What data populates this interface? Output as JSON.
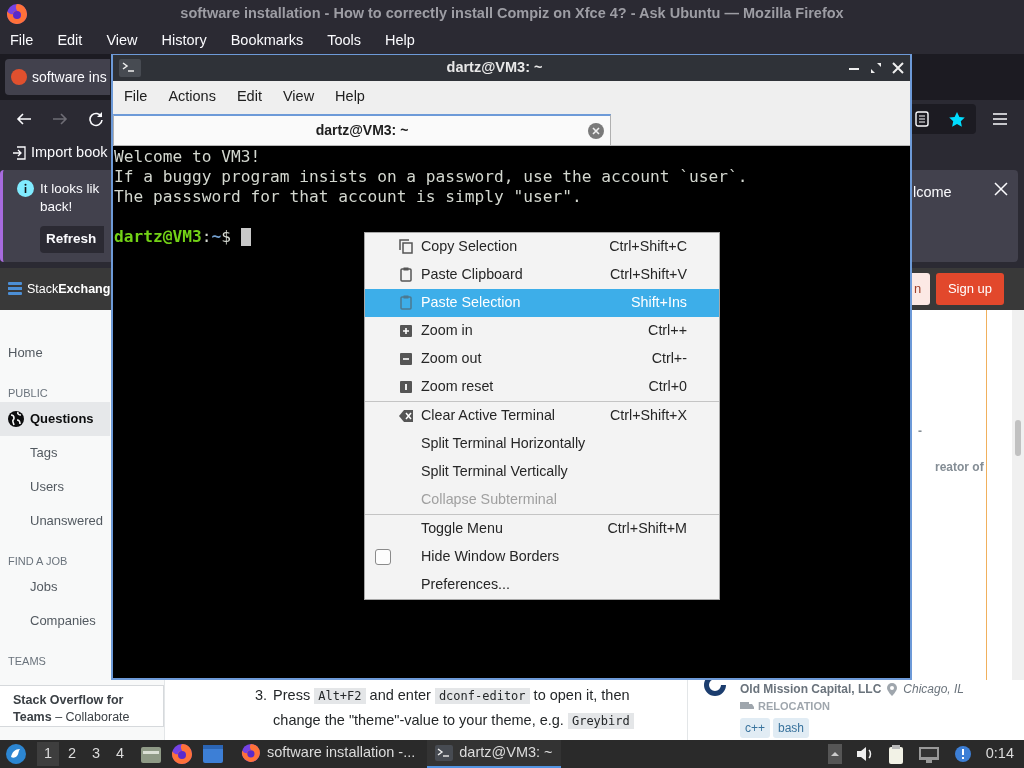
{
  "browser": {
    "title": "software installation - How to correctly install Compiz on Xfce 4? - Ask Ubuntu — Mozilla Firefox",
    "menu": [
      "File",
      "Edit",
      "View",
      "History",
      "Bookmarks",
      "Tools",
      "Help"
    ],
    "tab": {
      "title": "software ins",
      "selected": true
    },
    "nav": {
      "forward_disabled": true,
      "bookmarked": true
    },
    "bookmark": "Import book",
    "notice": {
      "lines": [
        "It looks lik",
        "back!"
      ],
      "button": "Refresh",
      "tail": "lcome"
    },
    "site_header": {
      "logo": "Stack**Exchang**",
      "login": "n",
      "signup": "Sign up"
    },
    "sidebar": [
      {
        "label": "Home",
        "kind": "link",
        "selected": false
      },
      {
        "label": "PUBLIC",
        "kind": "heading",
        "selected": false
      },
      {
        "label": "Questions",
        "kind": "main",
        "selected": true
      },
      {
        "label": "Tags",
        "kind": "sub",
        "selected": false
      },
      {
        "label": "Users",
        "kind": "sub",
        "selected": false
      },
      {
        "label": "Unanswered",
        "kind": "sub",
        "selected": false
      },
      {
        "label": "FIND A JOB",
        "kind": "heading",
        "selected": false
      },
      {
        "label": "Jobs",
        "kind": "sub",
        "selected": false
      },
      {
        "label": "Companies",
        "kind": "sub",
        "selected": false
      },
      {
        "label": "TEAMS",
        "kind": "heading",
        "selected": false
      }
    ],
    "teams": "**Stack Overflow for Teams** – Collaborate",
    "answer": {
      "number": "3.",
      "parts": [
        {
          "kind": "text",
          "text": "Press "
        },
        {
          "kind": "code",
          "text": "Alt+F2"
        },
        {
          "kind": "text",
          "text": " and enter "
        },
        {
          "kind": "code",
          "text": "dconf-editor"
        },
        {
          "kind": "text",
          "text": " to open it, then change the \"theme\"-value to your theme, e.g. "
        },
        {
          "kind": "code",
          "text": "Greybird"
        }
      ]
    },
    "side_notes": [
      "-",
      "reator of"
    ],
    "job": {
      "company": "Old Mission Capital, LLC",
      "location": "Chicago, IL",
      "perk": "RELOCATION",
      "tags": [
        "c++",
        "bash"
      ]
    }
  },
  "terminal": {
    "title": "dartz@VM3: ~",
    "menu": [
      "File",
      "Actions",
      "Edit",
      "View",
      "Help"
    ],
    "tab": {
      "title": "dartz@VM3: ~",
      "selected": true
    },
    "lines": [
      "Welcome to VM3!",
      "If a buggy program insists on a password, use the account `user`.",
      "The passsword for that account is simply \"user\"."
    ],
    "prompt": [
      {
        "kind": "user",
        "text": "dartz@VM3"
      },
      {
        "kind": "plain",
        "text": ":"
      },
      {
        "kind": "path",
        "text": "~"
      },
      {
        "kind": "plain",
        "text": "$"
      }
    ]
  },
  "context_menu": [
    {
      "kind": "item",
      "label": "Copy Selection",
      "shortcut": "Ctrl+Shift+C",
      "selected": false,
      "disabled": false
    },
    {
      "kind": "item",
      "label": "Paste Clipboard",
      "shortcut": "Ctrl+Shift+V",
      "selected": false,
      "disabled": false
    },
    {
      "kind": "item",
      "label": "Paste Selection",
      "shortcut": "Shift+Ins",
      "selected": true,
      "disabled": false
    },
    {
      "kind": "item",
      "label": "Zoom in",
      "shortcut": "Ctrl++",
      "selected": false,
      "disabled": false
    },
    {
      "kind": "item",
      "label": "Zoom out",
      "shortcut": "Ctrl+-",
      "selected": false,
      "disabled": false
    },
    {
      "kind": "item",
      "label": "Zoom reset",
      "shortcut": "Ctrl+0",
      "selected": false,
      "disabled": false
    },
    {
      "kind": "separator"
    },
    {
      "kind": "item",
      "label": "Clear Active Terminal",
      "shortcut": "Ctrl+Shift+X",
      "selected": false,
      "disabled": false
    },
    {
      "kind": "item",
      "label": "Split Terminal Horizontally",
      "selected": false,
      "disabled": false
    },
    {
      "kind": "item",
      "label": "Split Terminal Vertically",
      "selected": false,
      "disabled": false
    },
    {
      "kind": "item",
      "label": "Collapse Subterminal",
      "selected": false,
      "disabled": true
    },
    {
      "kind": "separator"
    },
    {
      "kind": "item",
      "label": "Toggle Menu",
      "shortcut": "Ctrl+Shift+M",
      "selected": false,
      "disabled": false
    },
    {
      "kind": "check",
      "label": "Hide Window Borders",
      "checked": false,
      "selected": false,
      "disabled": false
    },
    {
      "kind": "item",
      "label": "Preferences...",
      "selected": false,
      "disabled": false
    }
  ],
  "taskbar": {
    "workspaces": [
      {
        "label": "1",
        "selected": true
      },
      {
        "label": "2",
        "selected": false
      },
      {
        "label": "3",
        "selected": false
      },
      {
        "label": "4",
        "selected": false
      }
    ],
    "windows": [
      {
        "kind": "browser",
        "title": "software installation -...",
        "selected": false
      },
      {
        "kind": "terminal",
        "title": "dartz@VM3: ~",
        "selected": true
      }
    ],
    "clock": "0:14"
  }
}
